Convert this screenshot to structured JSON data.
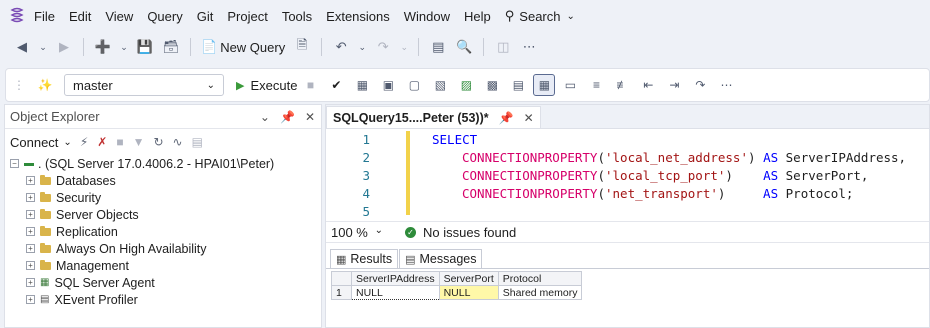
{
  "menu": {
    "items": [
      "File",
      "Edit",
      "View",
      "Query",
      "Git",
      "Project",
      "Tools",
      "Extensions",
      "Window",
      "Help"
    ],
    "search_label": "Search"
  },
  "toolbar1": {
    "new_query_label": "New Query"
  },
  "toolbar2": {
    "database": "master",
    "execute_label": "Execute"
  },
  "object_explorer": {
    "title": "Object Explorer",
    "connect_label": "Connect",
    "server_node": ". (SQL Server 17.0.4006.2 - HPAI01\\Peter)",
    "children": [
      "Databases",
      "Security",
      "Server Objects",
      "Replication",
      "Always On High Availability",
      "Management",
      "SQL Server Agent",
      "XEvent Profiler"
    ]
  },
  "editor": {
    "tab_title": "SQLQuery15....Peter (53))*",
    "lines": [
      {
        "n": "1"
      },
      {
        "n": "2"
      },
      {
        "n": "3"
      },
      {
        "n": "4"
      },
      {
        "n": "5"
      }
    ],
    "code": {
      "l1_kw": "SELECT",
      "l2_fn": "CONNECTIONPROPERTY",
      "l2_str": "'local_net_address'",
      "l2_as": "AS",
      "l2_alias": "ServerIPAddress,",
      "l3_fn": "CONNECTIONPROPERTY",
      "l3_str": "'local_tcp_port'",
      "l3_as": "AS",
      "l3_alias": "ServerPort,",
      "l4_fn": "CONNECTIONPROPERTY",
      "l4_str": "'net_transport'",
      "l4_as": "AS",
      "l4_alias": "Protocol;"
    },
    "zoom": "100 %",
    "issues": "No issues found"
  },
  "results": {
    "tabs": [
      "Results",
      "Messages"
    ],
    "columns": [
      "ServerIPAddress",
      "ServerPort",
      "Protocol"
    ],
    "rows": [
      {
        "num": "1",
        "cells": [
          "NULL",
          "NULL",
          "Shared memory"
        ]
      }
    ]
  }
}
